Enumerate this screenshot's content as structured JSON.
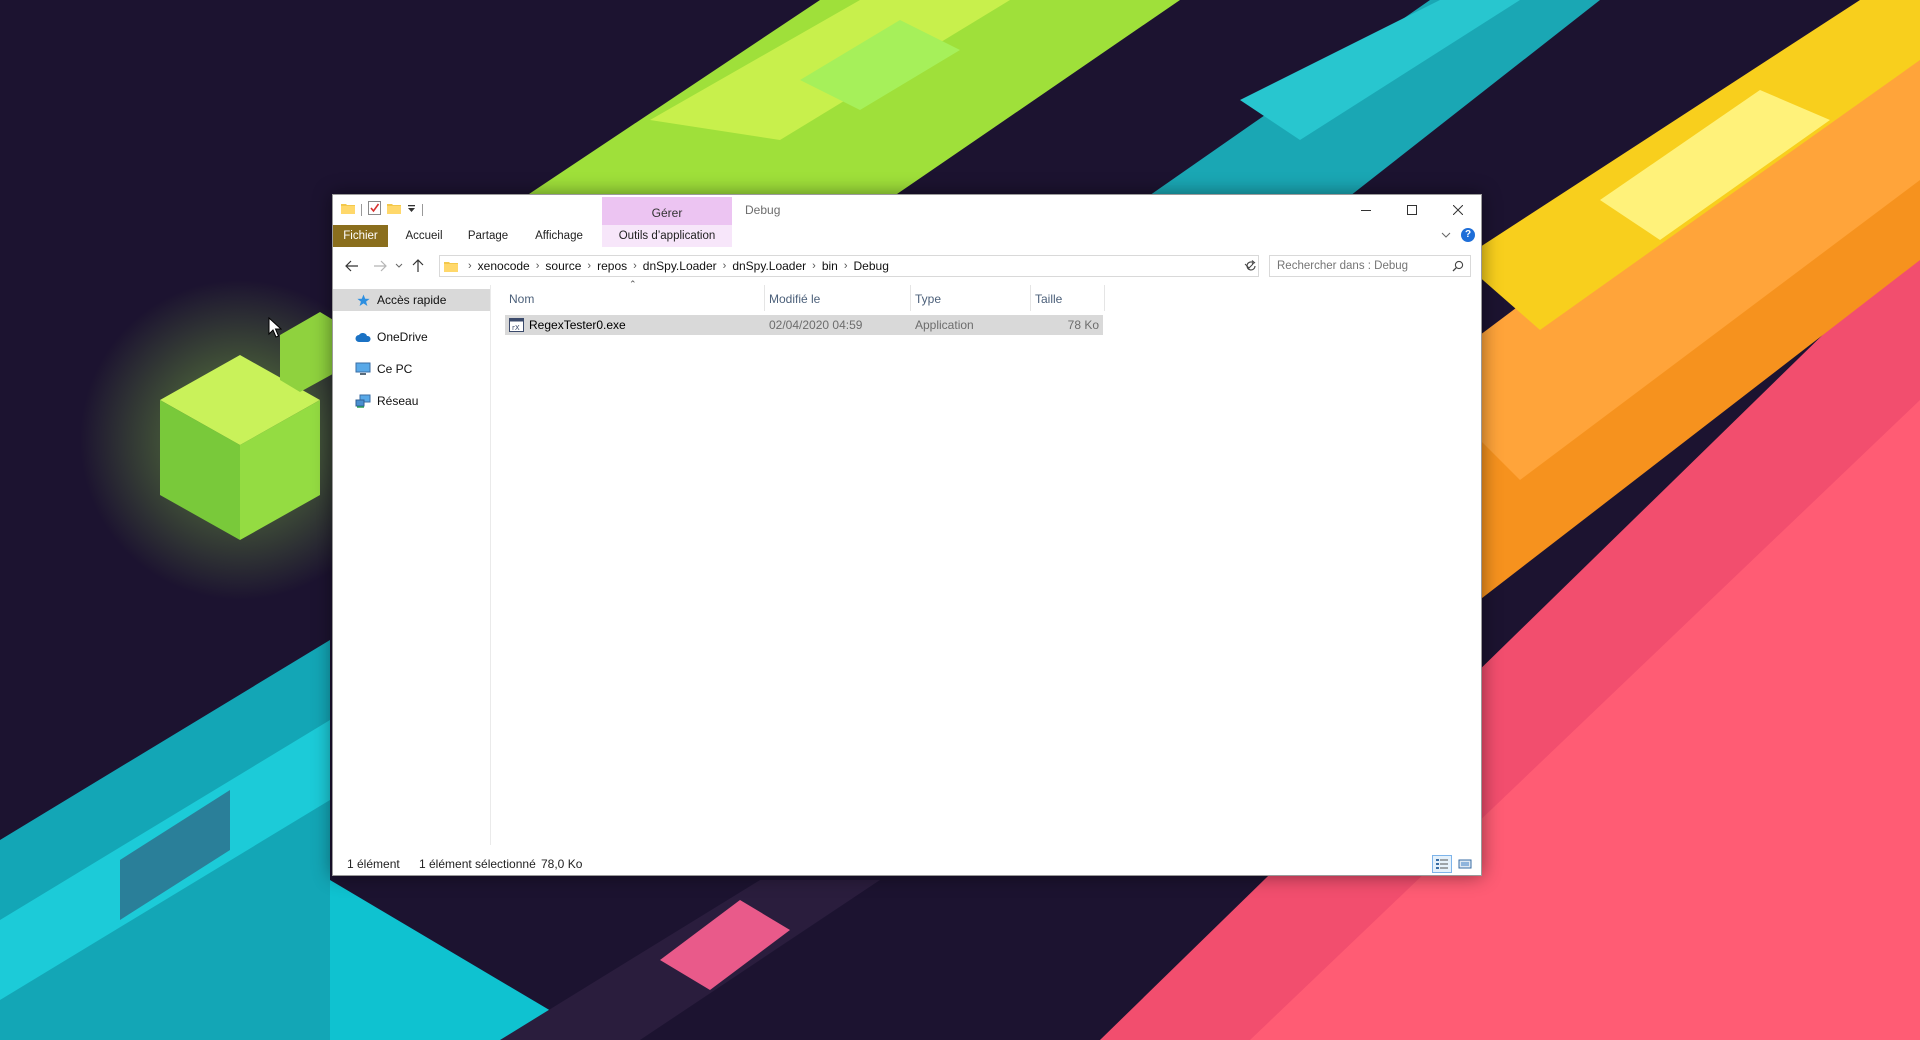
{
  "window": {
    "title": "Debug",
    "context_tab_group": "Gérer",
    "controls": {
      "minimize": "minimize",
      "maximize": "maximize",
      "close": "close"
    }
  },
  "ribbon": {
    "tabs": [
      {
        "label": "Fichier"
      },
      {
        "label": "Accueil"
      },
      {
        "label": "Partage"
      },
      {
        "label": "Affichage"
      },
      {
        "label": "Outils d’application"
      }
    ]
  },
  "address": {
    "breadcrumb": [
      "xenocode",
      "source",
      "repos",
      "dnSpy.Loader",
      "dnSpy.Loader",
      "bin",
      "Debug"
    ]
  },
  "search": {
    "placeholder": "Rechercher dans : Debug",
    "value": ""
  },
  "nav_pane": {
    "items": [
      {
        "label": "Accès rapide",
        "icon": "star-icon"
      },
      {
        "label": "OneDrive",
        "icon": "cloud-icon"
      },
      {
        "label": "Ce PC",
        "icon": "computer-icon"
      },
      {
        "label": "Réseau",
        "icon": "network-icon"
      }
    ]
  },
  "file_list": {
    "columns": [
      "Nom",
      "Modifié le",
      "Type",
      "Taille"
    ],
    "rows": [
      {
        "name": "RegexTester0.exe",
        "modified": "02/04/2020 04:59",
        "type": "Application",
        "size": "78 Ko"
      }
    ]
  },
  "status": {
    "count": "1 élément",
    "selection": "1 élément sélectionné",
    "selection_size": "78,0 Ko"
  },
  "colors": {
    "file_tab": "#8a6e1d",
    "context_tab": "#ecc4f2",
    "selection_row": "#d9d9d9",
    "header_text": "#4c607a"
  }
}
